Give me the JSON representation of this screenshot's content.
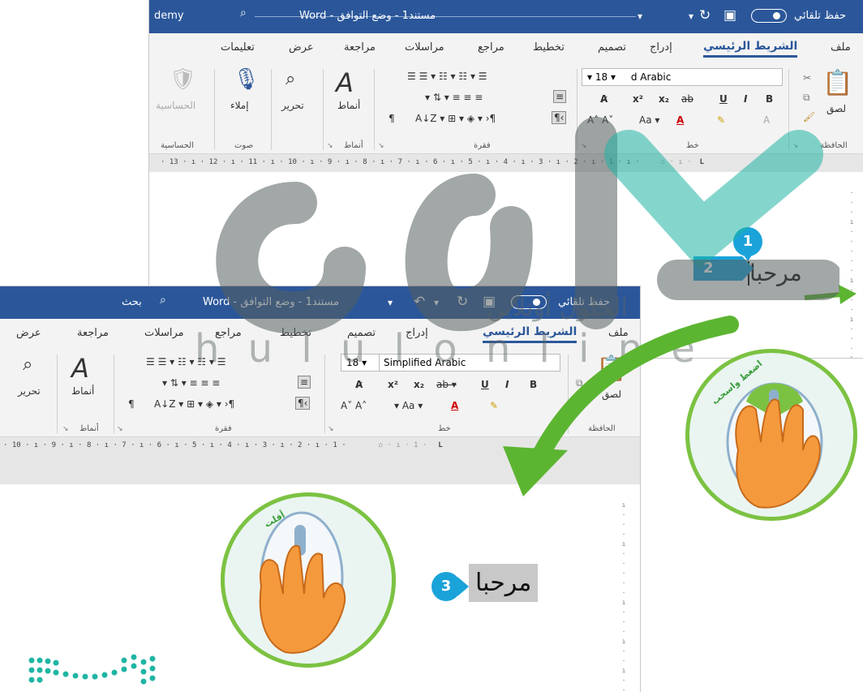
{
  "window1": {
    "title": "مستند1 - وضع التوافق - Word",
    "title_left_fragment": "demy",
    "autosave": "حفظ تلقائي",
    "tabs": [
      "ملف",
      "الشريط الرئيسي",
      "إدراج",
      "تصميم",
      "تخطيط",
      "مراجع",
      "مراسلات",
      "مراجعة",
      "عرض",
      "تعليمات"
    ],
    "active_tab": "الشريط الرئيسي",
    "font_name": "Simplified Arabic",
    "font_size": "18",
    "ribbon_labels": {
      "paste": "لصق",
      "clipboard": "الحافظة",
      "font": "خط",
      "paragraph": "فقرة",
      "styles_btn": "أنماط",
      "styles_group": "أنماط",
      "edit": "تحرير",
      "dictate": "إملاء",
      "voice": "صوت",
      "sensitivity_btn": "الحساسية",
      "sensitivity_group": "الحساسية"
    },
    "ruler": "· 13 · ı · 12 · ı · 11 · ı · 10 · ı · 9 · ı · 8 · ı · 7 · ı · 6 · ı · 5 · ı · 4 · ı · 3 · ı · 2 · ı · 1 · ı ·",
    "doc_text": "مرحبا",
    "callout_1": "1",
    "callout_2": "2"
  },
  "window2": {
    "title": "مستند1 - وضع التوافق - Word",
    "search": "بحث",
    "autosave": "حفظ تلقائي",
    "tabs": [
      "ملف",
      "الشريط الرئيسي",
      "إدراج",
      "تصميم",
      "تخطيط",
      "مراجع",
      "مراسلات",
      "مراجعة",
      "عرض"
    ],
    "active_tab": "الشريط الرئيسي",
    "font_name": "Simplified Arabic",
    "font_size": "18",
    "ribbon_labels": {
      "paste": "لصق",
      "clipboard": "الحافظة",
      "font": "خط",
      "paragraph": "فقرة",
      "styles_btn": "أنماط",
      "styles_group": "أنماط",
      "edit": "تحرير"
    },
    "ruler": "· 10 · ı · 9 · ı · 8 · ı · 7 · ı · 6 · ı · 5 · ı · 4 · ı · 3 · ı · 2 · ı · 1 ·",
    "doc_text": "مرحبا",
    "callout_3": "3"
  },
  "mouse_labels": {
    "drag": "اضغط واسحب",
    "release": "أفلت"
  },
  "watermark": {
    "arabic": "الحلول أونلاين",
    "latin": "h u l u l  o n l i n e"
  },
  "colors": {
    "word_blue": "#2b579a",
    "callout_blue": "#1aa3d9",
    "arrow_green": "#5cb531",
    "circle_green": "#7cc242",
    "logo_teal": "#1fb5a4"
  }
}
